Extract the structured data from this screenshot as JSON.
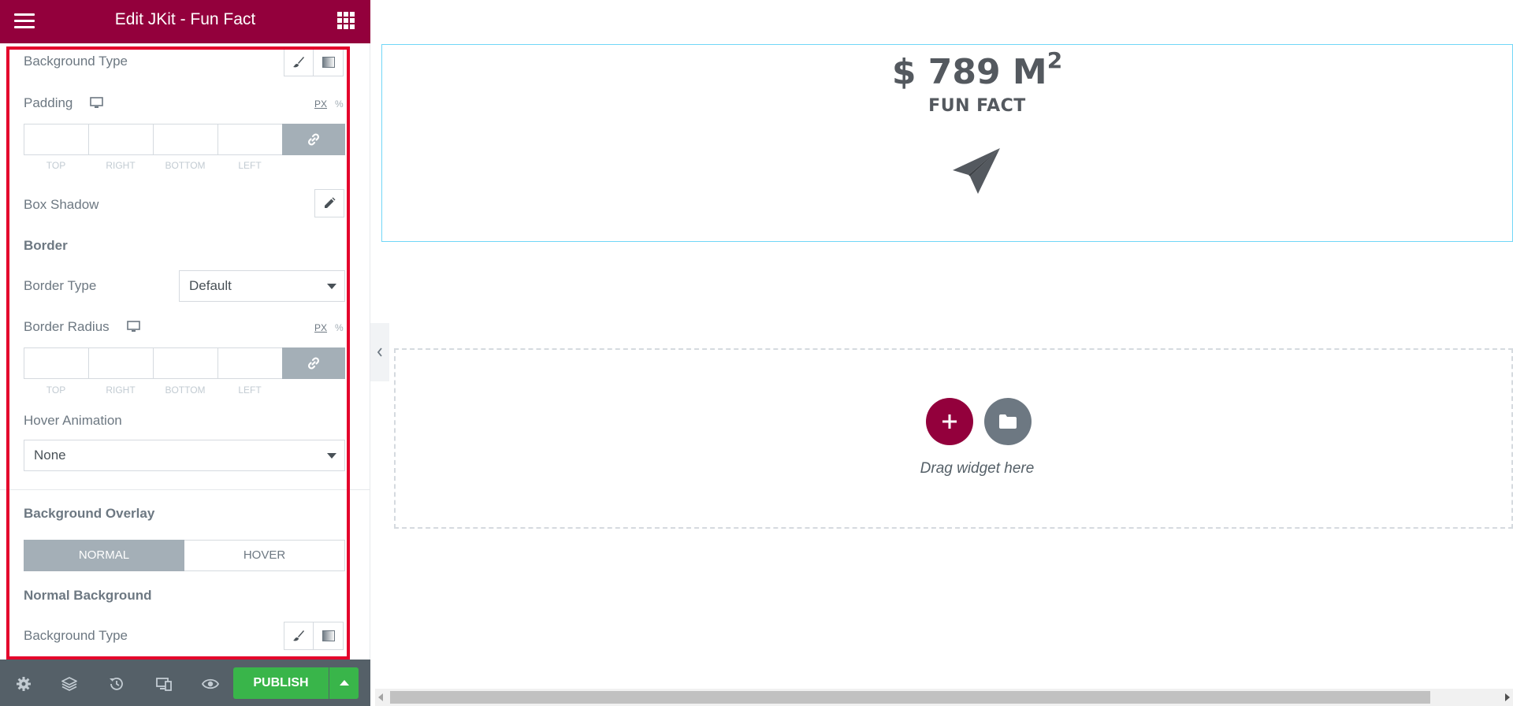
{
  "header": {
    "title": "Edit JKit - Fun Fact"
  },
  "section_style": {
    "background_type_label": "Background Type",
    "padding_label": "Padding",
    "units_px": "PX",
    "units_pct": "%",
    "dimension_labels": [
      "TOP",
      "RIGHT",
      "BOTTOM",
      "LEFT"
    ],
    "box_shadow_label": "Box Shadow",
    "border_heading": "Border",
    "border_type_label": "Border Type",
    "border_type_value": "Default",
    "border_radius_label": "Border Radius",
    "hover_animation_label": "Hover Animation",
    "hover_animation_value": "None"
  },
  "section_overlay": {
    "heading": "Background Overlay",
    "tabs": [
      "NORMAL",
      "HOVER"
    ],
    "active_tab": "NORMAL",
    "normal_background_heading": "Normal Background",
    "background_type_label": "Background Type"
  },
  "footer": {
    "publish_label": "PUBLISH"
  },
  "canvas": {
    "fun_fact_number": "$ 789 M",
    "fun_fact_sup": "2",
    "fun_fact_title": "FUN FACT",
    "drag_text": "Drag widget here"
  },
  "colors": {
    "brand": "#93003c",
    "publish": "#39b54a",
    "highlight": "#e4002b"
  }
}
